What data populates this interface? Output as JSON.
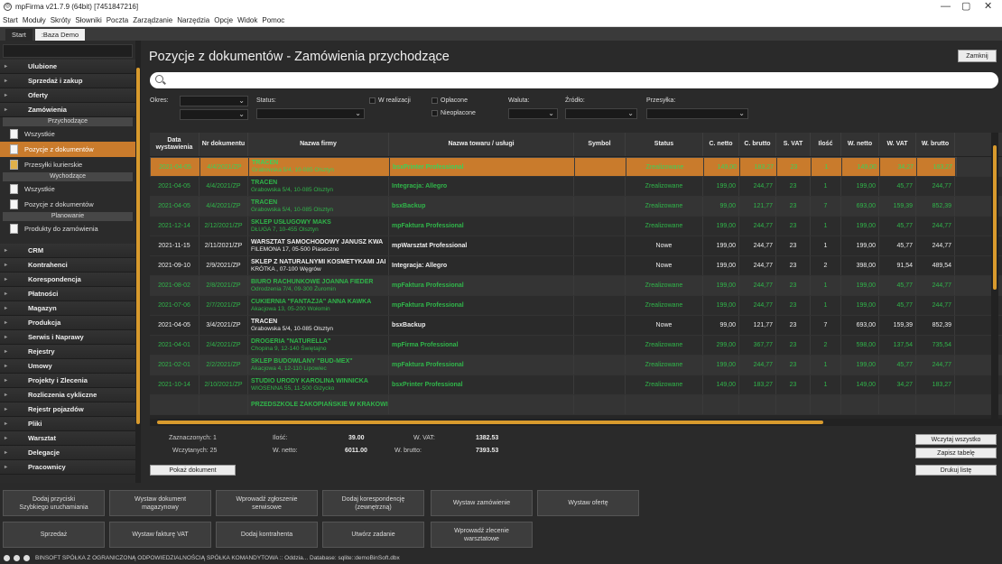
{
  "window": {
    "title": "mpFirma v21.7.9 (64bit) [7451847216]",
    "min": "—",
    "max": "▢",
    "close": "✕"
  },
  "menu": [
    "Start",
    "Moduły",
    "Skróty",
    "Słowniki",
    "Poczta",
    "Zarządzanie",
    "Narzędzia",
    "Opcje",
    "Widok",
    "Pomoc"
  ],
  "tabs": [
    "Start",
    ":Baza Demo"
  ],
  "sidebar": {
    "top_categories": [
      "Ulubione",
      "Sprzedaż i zakup",
      "Oferty",
      "Zamówienia"
    ],
    "sections": {
      "incoming": "Przychodzące",
      "outgoing": "Wychodzące",
      "planned": "Planowanie"
    },
    "incoming_items": [
      "Wszystkie",
      "Pozycje z dokumentów",
      "Przesyłki kurierskie"
    ],
    "outgoing_items": [
      "Wszystkie",
      "Pozycje z dokumentów"
    ],
    "planned_items": [
      "Produkty do zamówienia"
    ],
    "bottom_categories": [
      "CRM",
      "Kontrahenci",
      "Korespondencja",
      "Płatności",
      "Magazyn",
      "Produkcja",
      "Serwis i Naprawy",
      "Rejestry",
      "Umowy",
      "Projekty i Zlecenia",
      "Rozliczenia cykliczne",
      "Rejestr pojazdów",
      "Pliki",
      "Warsztat",
      "Delegacje",
      "Pracownicy"
    ]
  },
  "page": {
    "title": "Pozycje z dokumentów - Zamówienia przychodzące",
    "close_label": "Zamknij"
  },
  "filters": {
    "period": "Okres:",
    "status": "Status:",
    "in_progress": "W realizacji",
    "paid": "Opłacone",
    "unpaid": "Nieopłacone",
    "currency": "Waluta:",
    "source": "Źródło:",
    "shipping": "Przesyłka:"
  },
  "table": {
    "headers": [
      "Data wystawienia",
      "Nr dokumentu",
      "Nazwa firmy",
      "Nazwa towaru / usługi",
      "Symbol",
      "Status",
      "C. netto",
      "C. brutto",
      "S. VAT",
      "Ilość",
      "W. netto",
      "W. VAT",
      "W. brutto"
    ],
    "rows": [
      {
        "date": "2021-04-05",
        "nr": "4/4/2021/ZP",
        "firm": "TRACEN",
        "addr": "Grabowska 5/4, 10-085 Olsztyn",
        "product": "bsxPrinter Professional",
        "symbol": "",
        "status": "Zrealizowane",
        "cn": "149,00",
        "cb": "183,27",
        "vat": "23",
        "qty": "1",
        "wn": "149,00",
        "wv": "34,27",
        "wb": "183,27",
        "style": "sel"
      },
      {
        "date": "2021-04-05",
        "nr": "4/4/2021/ZP",
        "firm": "TRACEN",
        "addr": "Grabowska 5/4, 10-085 Olsztyn",
        "product": "mpFaktura Professional",
        "symbol": "",
        "status": "Zrealizowane",
        "cn": "199,00",
        "cb": "244,77",
        "vat": "23",
        "qty": "1",
        "wn": "199,00",
        "wv": "45,77",
        "wb": "244,77",
        "style": "green"
      },
      {
        "date": "2021-04-05",
        "nr": "4/4/2021/ZP",
        "firm": "TRACEN",
        "addr": "Grabowska 5/4, 10-085 Olsztyn",
        "product": "Integracja: Allegro",
        "symbol": "",
        "status": "Zrealizowane",
        "cn": "199,00",
        "cb": "244,77",
        "vat": "23",
        "qty": "1",
        "wn": "199,00",
        "wv": "45,77",
        "wb": "244,77",
        "style": "green"
      },
      {
        "date": "2021-04-05",
        "nr": "4/4/2021/ZP",
        "firm": "TRACEN",
        "addr": "Grabowska 5/4, 10-085 Olsztyn",
        "product": "bsxBackup",
        "symbol": "",
        "status": "Zrealizowane",
        "cn": "99,00",
        "cb": "121,77",
        "vat": "23",
        "qty": "7",
        "wn": "693,00",
        "wv": "159,39",
        "wb": "852,39",
        "style": "green"
      },
      {
        "date": "2021-12-14",
        "nr": "2/12/2021/ZP",
        "firm": "SKLEP USŁUGOWY MAKS",
        "addr": "DŁUGA 7, 10-455 Olsztyn",
        "product": "mpFaktura Professional",
        "symbol": "",
        "status": "Zrealizowane",
        "cn": "199,00",
        "cb": "244,77",
        "vat": "23",
        "qty": "1",
        "wn": "199,00",
        "wv": "45,77",
        "wb": "244,77",
        "style": "green"
      },
      {
        "date": "2021-11-15",
        "nr": "2/11/2021/ZP",
        "firm": "WARSZTAT SAMOCHODOWY JANUSZ KWA",
        "addr": "FILEMONA 17, 05-500 Piaseczno",
        "product": "mpWarsztat Professional",
        "symbol": "",
        "status": "Nowe",
        "cn": "199,00",
        "cb": "244,77",
        "vat": "23",
        "qty": "1",
        "wn": "199,00",
        "wv": "45,77",
        "wb": "244,77",
        "style": "white"
      },
      {
        "date": "2021-09-10",
        "nr": "2/9/2021/ZP",
        "firm": "SKLEP Z NATURALNYMI KOSMETYKAMI JAI",
        "addr": "KRÓTKA , 07-100 Węgrów",
        "product": "Integracja: Allegro",
        "symbol": "",
        "status": "Nowe",
        "cn": "199,00",
        "cb": "244,77",
        "vat": "23",
        "qty": "2",
        "wn": "398,00",
        "wv": "91,54",
        "wb": "489,54",
        "style": "white"
      },
      {
        "date": "2021-08-02",
        "nr": "2/8/2021/ZP",
        "firm": "BIURO RACHUNKOWE JOANNA FIEDER",
        "addr": "Odrodzenia 7/4, 09-300 Żuromin",
        "product": "mpFaktura Professional",
        "symbol": "",
        "status": "Zrealizowane",
        "cn": "199,00",
        "cb": "244,77",
        "vat": "23",
        "qty": "1",
        "wn": "199,00",
        "wv": "45,77",
        "wb": "244,77",
        "style": "green"
      },
      {
        "date": "2021-07-06",
        "nr": "2/7/2021/ZP",
        "firm": "CUKIERNIA \"FANTAZJA\" ANNA KAWKA",
        "addr": "Akacjowa 13, 05-200 Wołomin",
        "product": "mpFaktura Professional",
        "symbol": "",
        "status": "Zrealizowane",
        "cn": "199,00",
        "cb": "244,77",
        "vat": "23",
        "qty": "1",
        "wn": "199,00",
        "wv": "45,77",
        "wb": "244,77",
        "style": "green"
      },
      {
        "date": "2021-04-05",
        "nr": "3/4/2021/ZP",
        "firm": "TRACEN",
        "addr": "Grabowska 5/4, 10-085 Olsztyn",
        "product": "bsxBackup",
        "symbol": "",
        "status": "Nowe",
        "cn": "99,00",
        "cb": "121,77",
        "vat": "23",
        "qty": "7",
        "wn": "693,00",
        "wv": "159,39",
        "wb": "852,39",
        "style": "white"
      },
      {
        "date": "2021-04-01",
        "nr": "2/4/2021/ZP",
        "firm": "DROGERIA \"NATURELLA\"",
        "addr": "Chopina 9, 12-140 Świętajno",
        "product": "mpFirma Professional",
        "symbol": "",
        "status": "Zrealizowane",
        "cn": "299,00",
        "cb": "367,77",
        "vat": "23",
        "qty": "2",
        "wn": "598,00",
        "wv": "137,54",
        "wb": "735,54",
        "style": "green"
      },
      {
        "date": "2021-02-01",
        "nr": "2/2/2021/ZP",
        "firm": "SKLEP BUDOWLANY \"BUD-MEX\"",
        "addr": "Akacjowa 4, 12-110 Lipowiec",
        "product": "mpFaktura Professional",
        "symbol": "",
        "status": "Zrealizowane",
        "cn": "199,00",
        "cb": "244,77",
        "vat": "23",
        "qty": "1",
        "wn": "199,00",
        "wv": "45,77",
        "wb": "244,77",
        "style": "green"
      },
      {
        "date": "2021-10-14",
        "nr": "2/10/2021/ZP",
        "firm": "STUDIO URODY KAROLINA WINNICKA",
        "addr": "WIOSENNA 55, 11-500 Giżycko",
        "product": "bsxPrinter Professional",
        "symbol": "",
        "status": "Zrealizowane",
        "cn": "149,00",
        "cb": "183,27",
        "vat": "23",
        "qty": "1",
        "wn": "149,00",
        "wv": "34,27",
        "wb": "183,27",
        "style": "green"
      },
      {
        "date": "",
        "nr": "",
        "firm": "PRZEDSZKOLE ZAKOPIAŃSKIE W KRAKOWIE",
        "addr": "",
        "product": "",
        "symbol": "",
        "status": "",
        "cn": "",
        "cb": "",
        "vat": "",
        "qty": "",
        "wn": "",
        "wv": "",
        "wb": "",
        "style": "green"
      }
    ]
  },
  "summary": {
    "selected_label": "Zaznaczonych: 1",
    "loaded_label": "Wczytanych: 25",
    "qty_label": "Ilość:",
    "qty": "39.00",
    "wnet_label": "W. netto:",
    "wnet": "6011.00",
    "wvat_label": "W. VAT:",
    "wvat": "1382.53",
    "wbrut_label": "W. brutto:",
    "wbrut": "7393.53"
  },
  "buttons": {
    "load_all": "Wczytaj wszystko",
    "save_table": "Zapisz tabelę",
    "show_doc": "Pokaż dokument",
    "print_list": "Drukuj listę"
  },
  "quick": [
    "Dodaj przyciski\nSzybkiego uruchamiania",
    "Wystaw dokument\nmagazynowy",
    "Wprowadź zgłoszenie\nserwisowe",
    "Dodaj korespondencję\n(zewnętrzną)",
    "Wystaw zamówienie",
    "Wystaw ofertę",
    "Sprzedaż",
    "Wystaw fakturę VAT",
    "Dodaj kontrahenta",
    "Utwórz zadanie",
    "Wprowadź zlecenie\nwarsztatowe"
  ],
  "status_bar": "BINSOFT SPÓŁKA Z OGRANICZONĄ ODPOWIEDZIALNOŚCIĄ SPÓŁKA KOMANDYTOWA :: Oddzia... Database: sqlite::demoBinSoft.dbx",
  "colors": {
    "accent": "#c97b2c",
    "green_text": "#30b54a",
    "scroll": "#d89a2d"
  }
}
